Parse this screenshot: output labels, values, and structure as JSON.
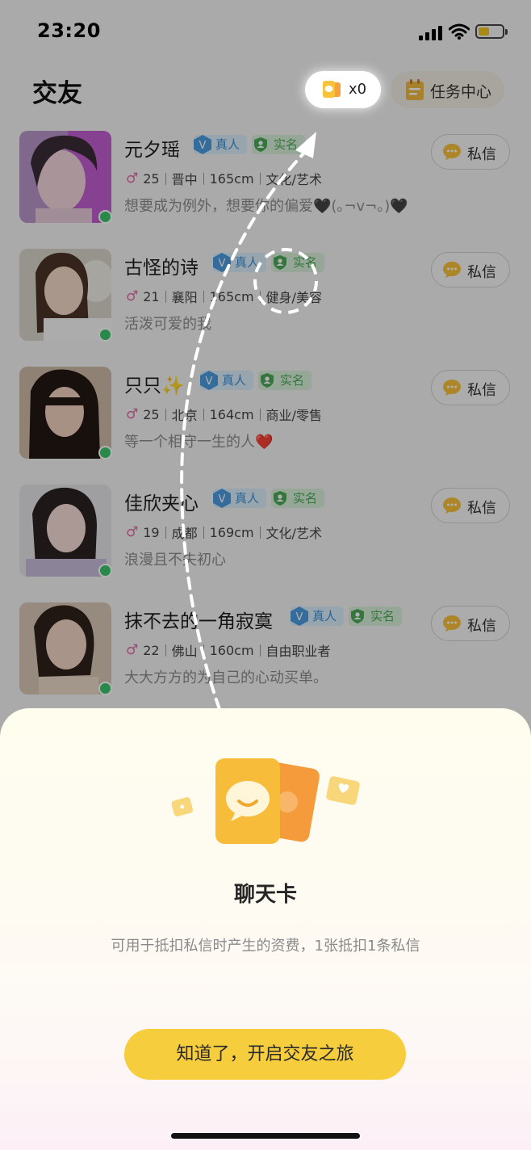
{
  "status_bar": {
    "time": "23:20",
    "battery_level": 0.45
  },
  "header": {
    "title": "交友",
    "chat_card_count": "x0",
    "task_center_label": "任务中心"
  },
  "users": [
    {
      "name": "元夕瑶",
      "real_badge": "真人",
      "verified_badge": "实名",
      "age": "25",
      "city": "晋中",
      "height": "165cm",
      "industry": "文化/艺术",
      "bio": "想要成为例外，想要你的偏爱🖤(｡¬v¬｡)🖤",
      "dm_label": "私信",
      "online": true
    },
    {
      "name": "古怪的诗",
      "real_badge": "真人",
      "verified_badge": "实名",
      "age": "21",
      "city": "襄阳",
      "height": "165cm",
      "industry": "健身/美容",
      "bio": "活泼可爱的我",
      "dm_label": "私信",
      "online": true
    },
    {
      "name": "只只✨",
      "real_badge": "真人",
      "verified_badge": "实名",
      "age": "25",
      "city": "北京",
      "height": "164cm",
      "industry": "商业/零售",
      "bio": "等一个相守一生的人❤️",
      "dm_label": "私信",
      "online": true
    },
    {
      "name": "佳欣夹心",
      "real_badge": "真人",
      "verified_badge": "实名",
      "age": "19",
      "city": "成都",
      "height": "169cm",
      "industry": "文化/艺术",
      "bio": "浪漫且不失初心",
      "dm_label": "私信",
      "online": true
    },
    {
      "name": "抹不去的一角寂寞",
      "real_badge": "真人",
      "verified_badge": "实名",
      "age": "22",
      "city": "佛山",
      "height": "160cm",
      "industry": "自由职业者",
      "bio": "大大方方的为自己的心动买单。",
      "dm_label": "私信",
      "online": true
    }
  ],
  "sheet": {
    "title": "聊天卡",
    "description": "可用于抵扣私信时产生的资费，1张抵扣1条私信",
    "button_label": "知道了，开启交友之旅"
  },
  "colors": {
    "accent": "#f6cd3c",
    "online": "#3bc46b",
    "real_badge": "#3f8fd0",
    "verified_badge": "#4da85a"
  }
}
